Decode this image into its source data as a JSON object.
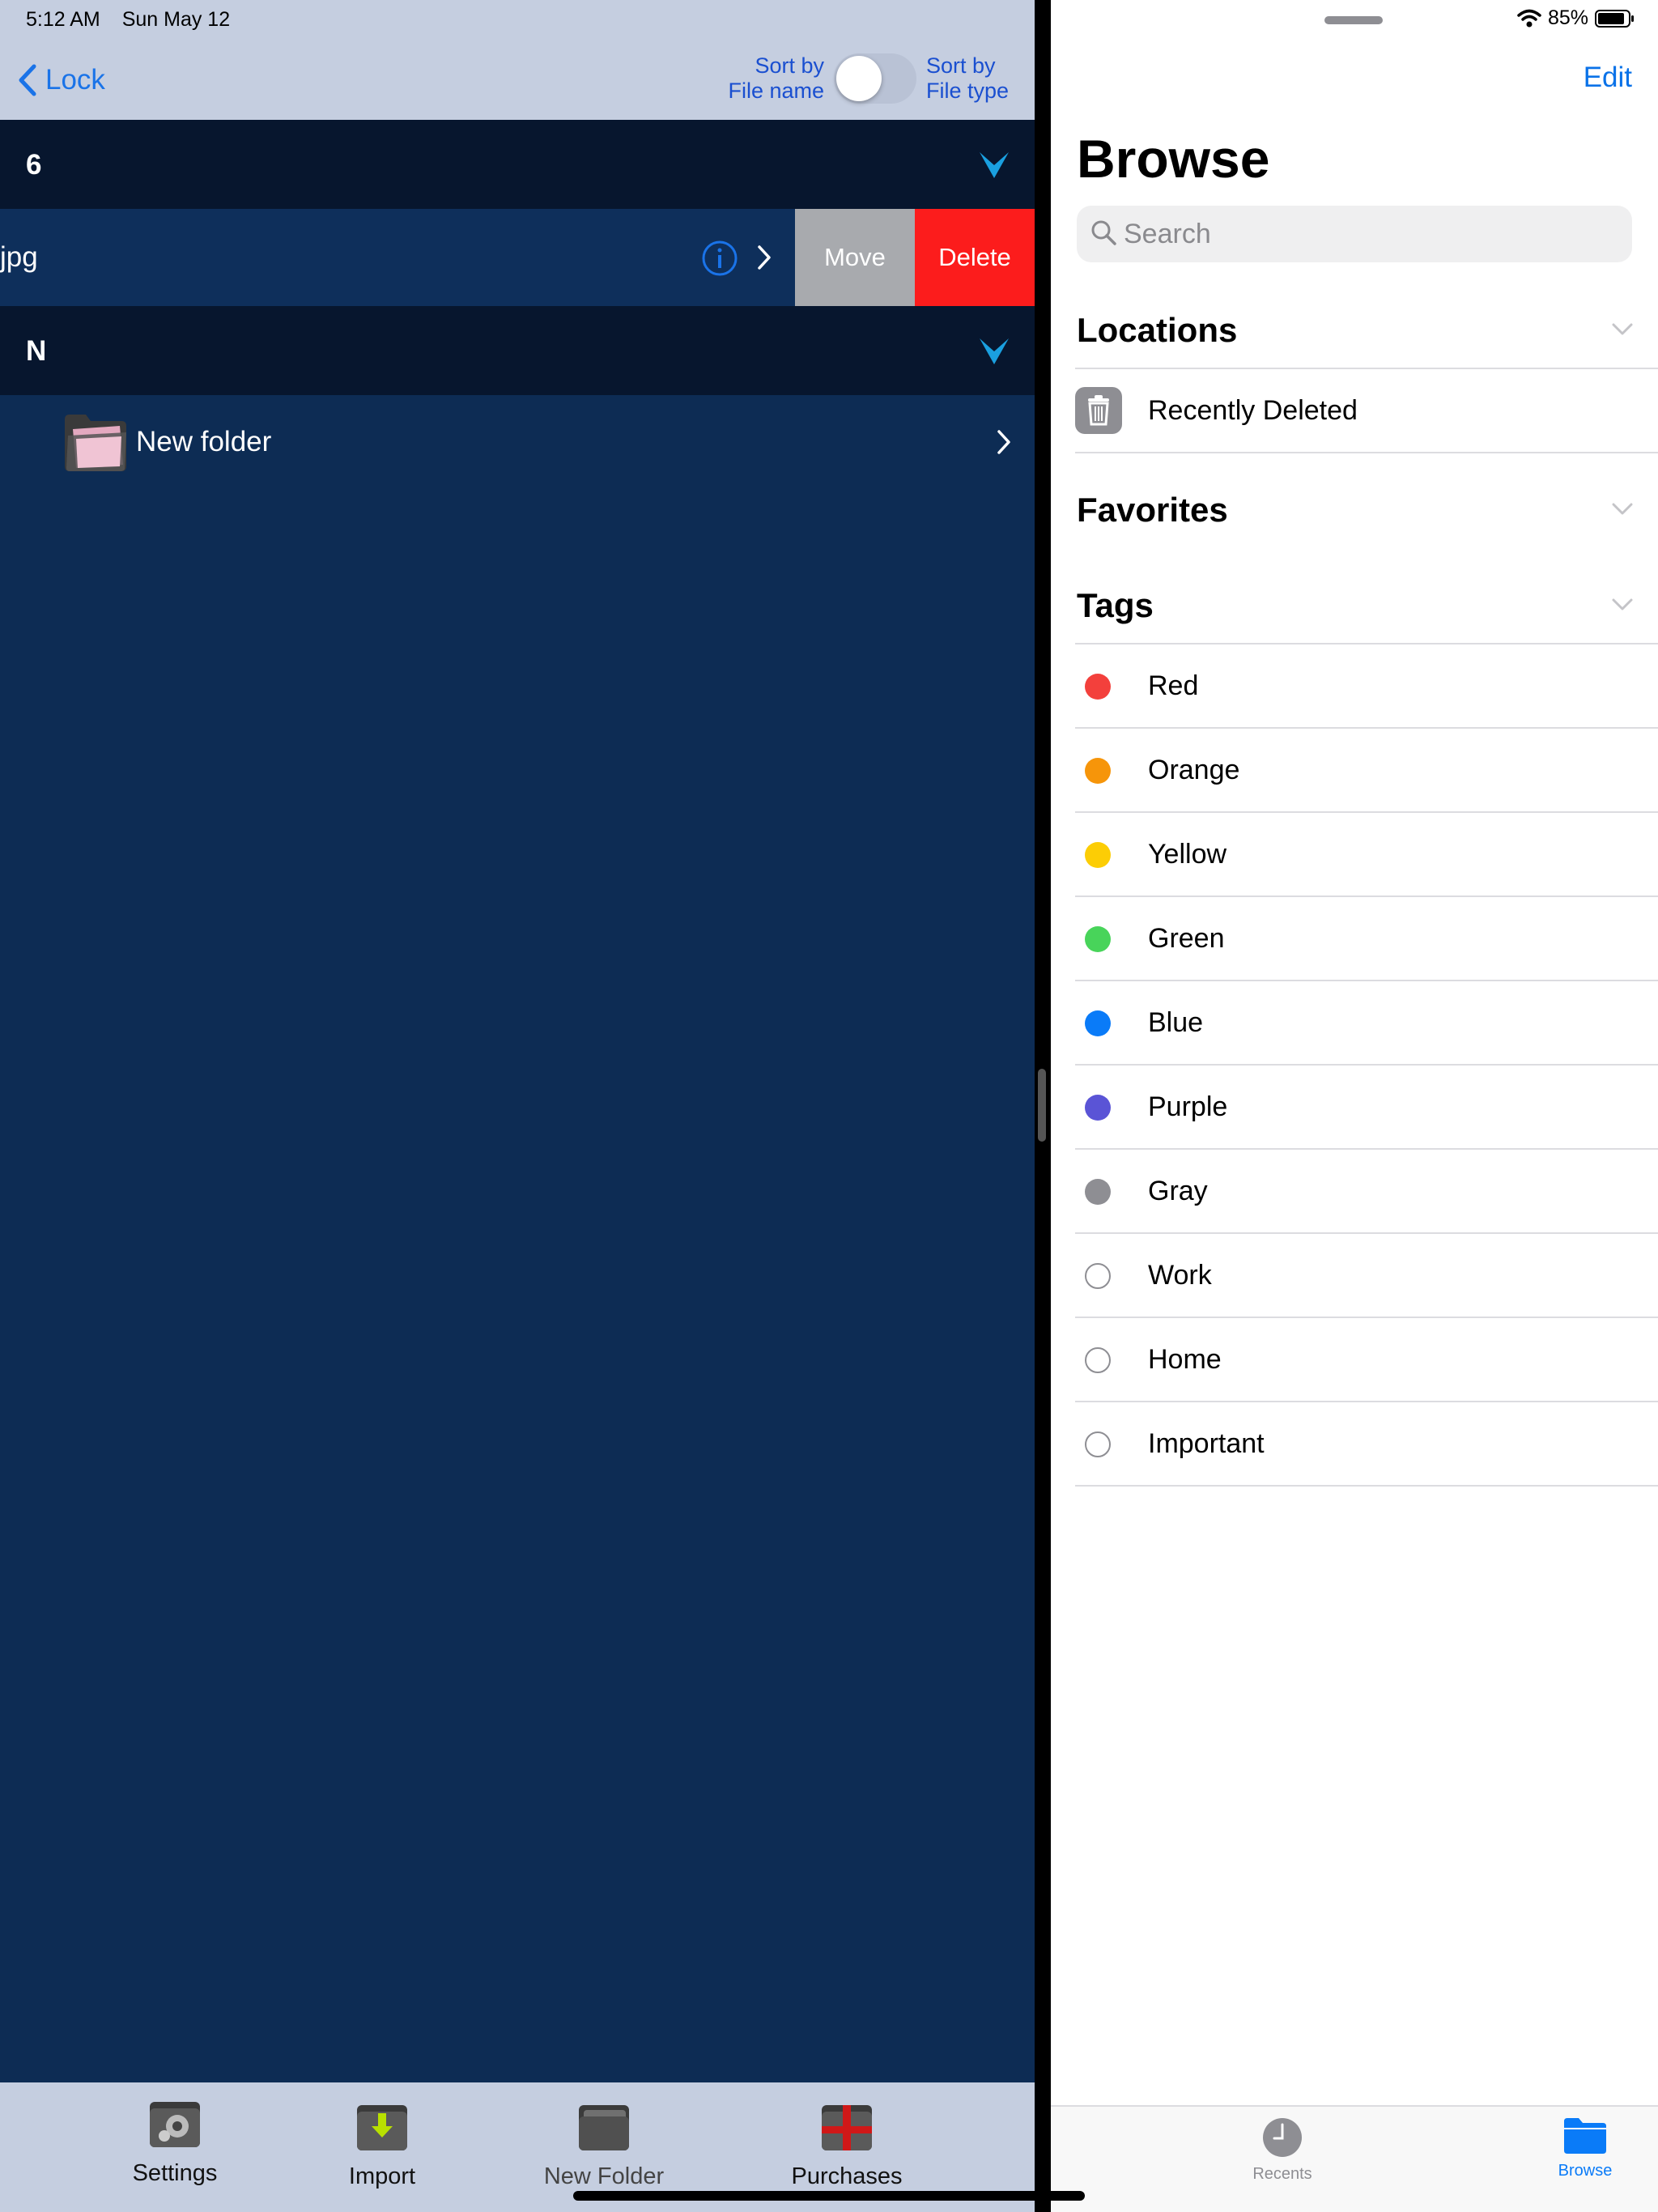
{
  "left": {
    "status": {
      "time": "5:12 AM",
      "date": "Sun May 12"
    },
    "nav": {
      "back_label": "Lock"
    },
    "sort": {
      "left_line1": "Sort by",
      "left_line2": "File name",
      "right_line1": "Sort by",
      "right_line2": "File type"
    },
    "sections": [
      {
        "label": "6"
      },
      {
        "label": "N"
      }
    ],
    "file_row": {
      "name": "jpg",
      "move_label": "Move",
      "delete_label": "Delete"
    },
    "folder_row": {
      "name": "New folder"
    },
    "toolbar": [
      {
        "label": "Settings"
      },
      {
        "label": "Import"
      },
      {
        "label": "New Folder"
      },
      {
        "label": "Purchases"
      }
    ],
    "colors": {
      "background": "#0d2c54",
      "bar": "#c5cee0",
      "delete": "#fc1c1c",
      "move": "#a8aaae",
      "accent": "#1aa0e0"
    }
  },
  "right": {
    "status": {
      "battery": "85%"
    },
    "edit_label": "Edit",
    "title": "Browse",
    "search_placeholder": "Search",
    "locations": {
      "heading": "Locations",
      "items": [
        {
          "label": "Recently Deleted",
          "icon": "trash-icon"
        }
      ]
    },
    "favorites": {
      "heading": "Favorites"
    },
    "tags": {
      "heading": "Tags",
      "items": [
        {
          "label": "Red",
          "color": "#f3403c"
        },
        {
          "label": "Orange",
          "color": "#f6950a"
        },
        {
          "label": "Yellow",
          "color": "#fccd05"
        },
        {
          "label": "Green",
          "color": "#48d45a"
        },
        {
          "label": "Blue",
          "color": "#0a7bf8"
        },
        {
          "label": "Purple",
          "color": "#5a54d6"
        },
        {
          "label": "Gray",
          "color": "#8e8e93"
        },
        {
          "label": "Work",
          "color": ""
        },
        {
          "label": "Home",
          "color": ""
        },
        {
          "label": "Important",
          "color": ""
        }
      ]
    },
    "tabbar": {
      "recents_label": "Recents",
      "browse_label": "Browse",
      "active_color": "#0a7bf8",
      "inactive_color": "#8e8e93"
    }
  }
}
